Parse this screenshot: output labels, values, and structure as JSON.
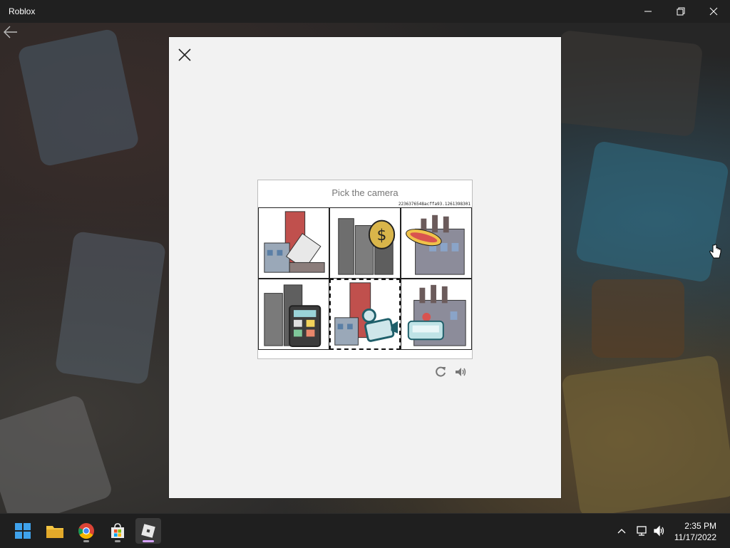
{
  "window": {
    "title": "Roblox",
    "controls": [
      "minimize",
      "restore",
      "close"
    ]
  },
  "captcha": {
    "prompt": "Pick the camera",
    "hash": "2236376548acffa93.1261398301",
    "tiles": [
      {
        "content": "building-with-refrigerator",
        "selected": false
      },
      {
        "content": "skyscraper-with-money-bag",
        "selected": false
      },
      {
        "content": "factory-with-hotdog",
        "selected": false
      },
      {
        "content": "skyscraper-with-calculator",
        "selected": false
      },
      {
        "content": "building-with-movie-camera",
        "selected": true
      },
      {
        "content": "factory-with-sofa",
        "selected": false
      }
    ],
    "tools": [
      "refresh-icon",
      "audio-icon"
    ]
  },
  "taskbar": {
    "apps": [
      "start-icon",
      "file-explorer-icon",
      "chrome-icon",
      "microsoft-store-icon",
      "roblox-icon"
    ],
    "active_app": "roblox-icon",
    "tray_icons": [
      "chevron-up-icon",
      "network-icon",
      "volume-icon"
    ],
    "time": "2:35 PM",
    "date": "11/17/2022"
  },
  "colors": {
    "titlebar": "#202020",
    "modal_bg": "#f2f2f2",
    "taskbar": "#1f1f1f",
    "active_indicator": "#d6a3ff"
  }
}
